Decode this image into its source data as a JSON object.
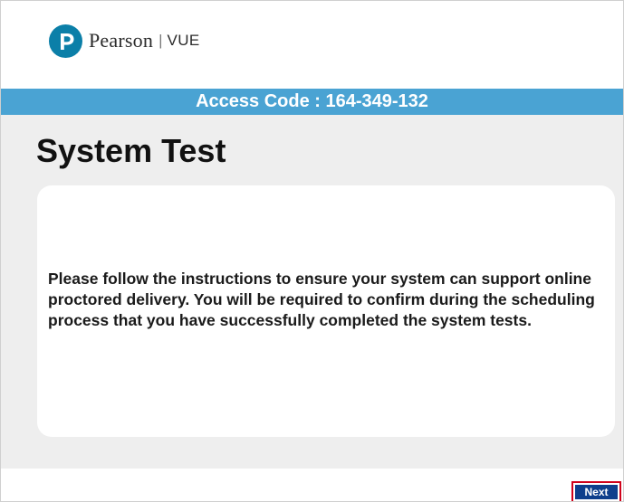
{
  "header": {
    "logo": {
      "icon": "pearson-p-logo-icon",
      "name": "Pearson",
      "separator": "|",
      "product": "VUE"
    }
  },
  "access_bar": {
    "text": "Access Code : 164-349-132"
  },
  "main": {
    "title": "System Test",
    "body": "Please follow the instructions to ensure your system can support online proctored delivery.  You will be required to confirm during the scheduling process that you have successfully completed the system tests."
  },
  "footer": {
    "next_label": "Next"
  },
  "colors": {
    "brand_blue": "#0b7fa8",
    "access_bar": "#4aa3d3",
    "content_bg": "#eeeeee",
    "next_button": "#0e3f8c",
    "highlight_border": "#d0021b"
  }
}
